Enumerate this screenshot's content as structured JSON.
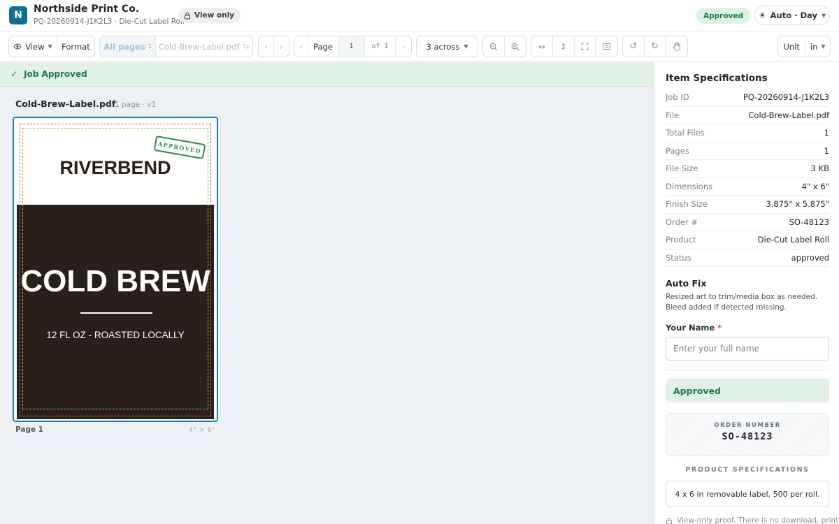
{
  "header": {
    "logo_letter": "N",
    "company": "Northside Print Co.",
    "subtitle": "PQ-20260914-J1K2L3 · Die-Cut Label Roll",
    "view_only": "View only",
    "status_pill": "Approved",
    "theme_label": "Auto · Day"
  },
  "toolbar": {
    "view_label": "View",
    "format_label": "Format",
    "all_pages_label": "All pages",
    "all_pages_count": "1",
    "file_tab_label": "Cold-Brew-Label.pdf",
    "file_tab_pages": "1p",
    "page_label": "Page",
    "page_current": "1",
    "page_of": "of",
    "page_total": "1",
    "layout_label": "3 across",
    "unit_label": "Unit",
    "unit_value": "in"
  },
  "banner": {
    "text": "Job Approved"
  },
  "document": {
    "filename": "Cold-Brew-Label.pdf",
    "meta": "1 page · v1",
    "page_label": "Page 1",
    "page_dims": "4\" × 6\""
  },
  "proof": {
    "brand": "RIVERBEND",
    "stamp": "APPROVED",
    "product": "COLD BREW",
    "tagline": "12 FL OZ  -  ROASTED LOCALLY"
  },
  "sidebar": {
    "title": "Item Specifications",
    "specs": [
      {
        "key": "Job ID",
        "value": "PQ-20260914-J1K2L3"
      },
      {
        "key": "File",
        "value": "Cold-Brew-Label.pdf"
      },
      {
        "key": "Total Files",
        "value": "1"
      },
      {
        "key": "Pages",
        "value": "1"
      },
      {
        "key": "File Size",
        "value": "3 KB"
      },
      {
        "key": "Dimensions",
        "value": "4\" x 6\""
      },
      {
        "key": "Finish Size",
        "value": "3.875\" x 5.875\""
      },
      {
        "key": "Order #",
        "value": "SO-48123"
      },
      {
        "key": "Product",
        "value": "Die-Cut Label Roll"
      },
      {
        "key": "Status",
        "value": "approved"
      }
    ],
    "auto_fix_title": "Auto Fix",
    "auto_fix_text": "Resized art to trim/media box as needed. Bleed added if detected missing.",
    "name_label": "Your Name",
    "name_required": "*",
    "name_placeholder": "Enter your full name",
    "approved_label": "Approved",
    "order_number_label": "ORDER NUMBER",
    "order_number_value": "SO-48123",
    "product_specs_title": "PRODUCT SPECIFICATIONS",
    "product_specs_text": "4 x 6 in removable label, 500 per roll.",
    "footnote": "View-only proof. There is no download, print"
  },
  "colors": {
    "brand_blue": "#0f6e93",
    "approved_green": "#1d7a45",
    "approved_bg": "#e1f1e8",
    "label_dark": "#2a201b",
    "selection_blue": "#1a7db2"
  }
}
